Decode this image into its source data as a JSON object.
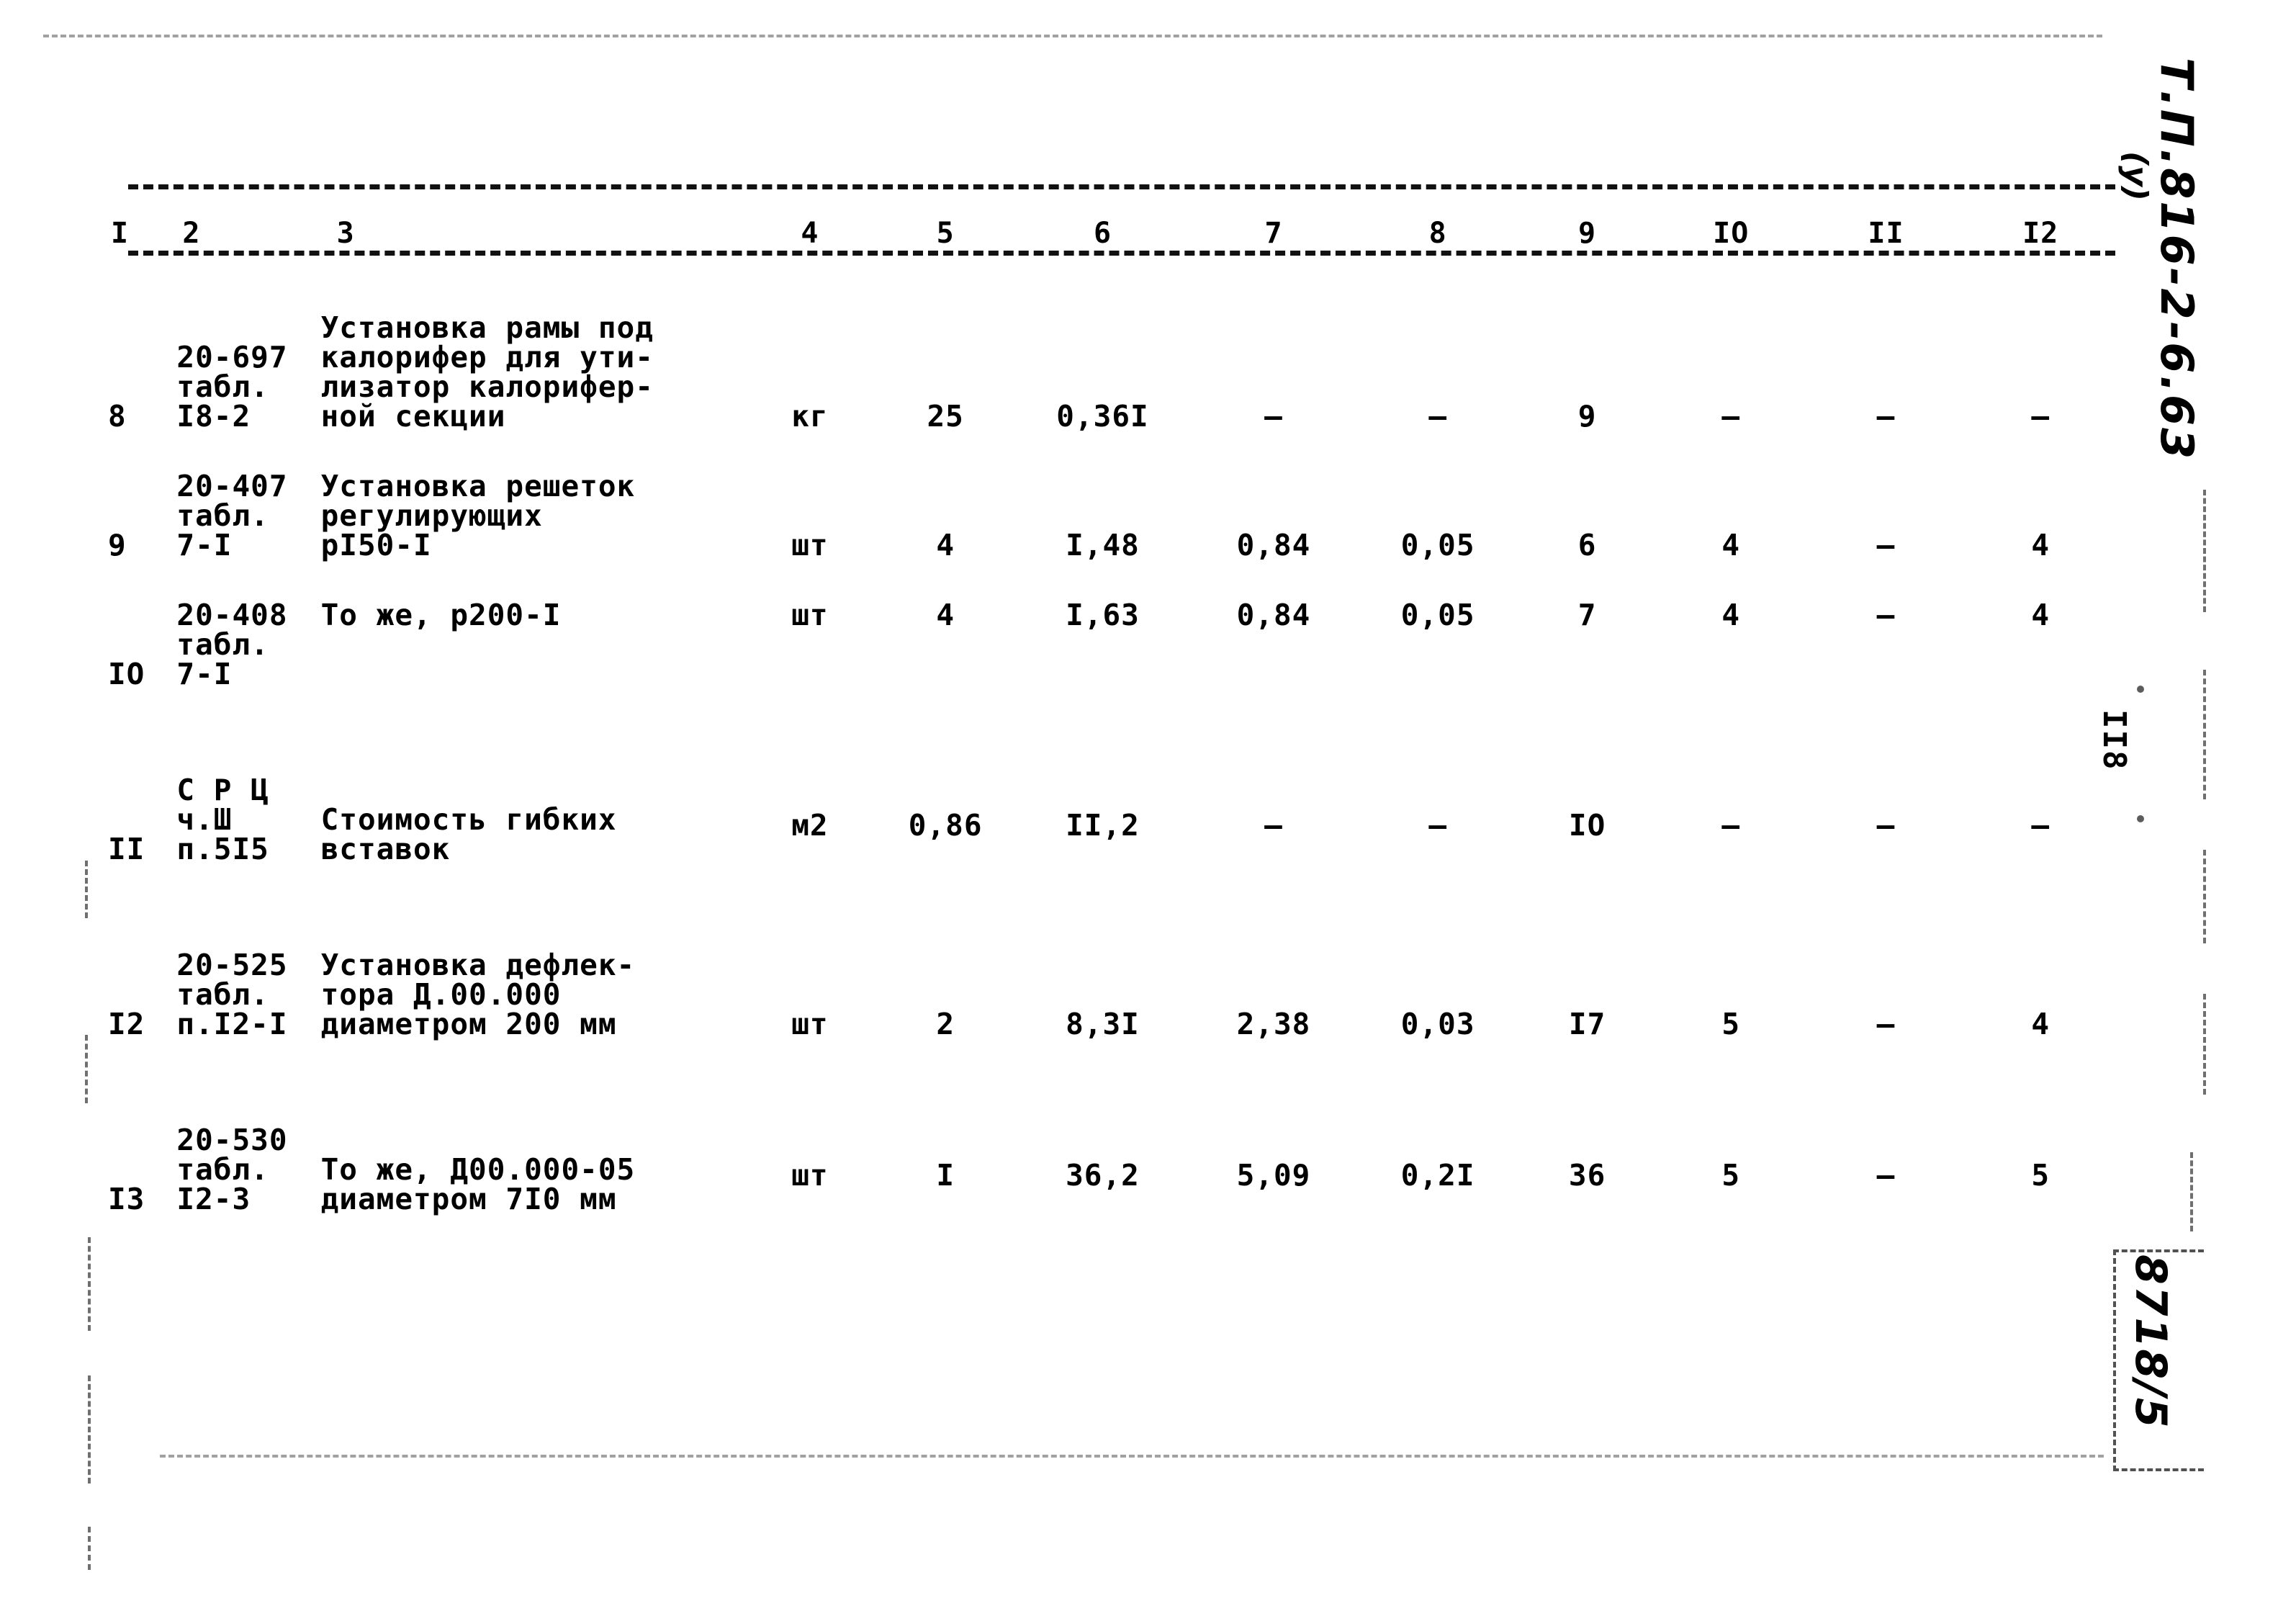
{
  "document": {
    "code": "Т.П.816-2-6.63",
    "code_sub": "(у)",
    "page_number": "II8",
    "sheet_code": "8718/5"
  },
  "table": {
    "headers": [
      "I",
      "2",
      "3",
      "4",
      "5",
      "6",
      "7",
      "8",
      "9",
      "IO",
      "II",
      "I2"
    ],
    "rows": [
      {
        "num": "8",
        "code": "20-697\nтабл.\nI8-2",
        "description": "Установка рамы под\nкалорифер для ути-\nлизатор калорифер-\nной секции",
        "unit": "кг",
        "v5": "25",
        "v6": "0,36I",
        "v7": "–",
        "v8": "–",
        "v9": "9",
        "v10": "–",
        "v11": "–",
        "v12": "–"
      },
      {
        "num": "9",
        "code": "20-407\nтабл.\n7-I",
        "description": "Установка решеток\nрегулирующих\nрI50-I",
        "unit": "шт",
        "v5": "4",
        "v6": "I,48",
        "v7": "0,84",
        "v8": "0,05",
        "v9": "6",
        "v10": "4",
        "v11": "–",
        "v12": "4"
      },
      {
        "num": "IO",
        "code": "20-408\nтабл.\n7-I",
        "description": "То же, р200-I",
        "unit": "шт",
        "v5": "4",
        "v6": "I,63",
        "v7": "0,84",
        "v8": "0,05",
        "v9": "7",
        "v10": "4",
        "v11": "–",
        "v12": "4"
      },
      {
        "num": "II",
        "code": "С Р Ц\nч.Ш\nп.5I5",
        "description": "Стоимость гибких\nвставок",
        "unit": "м2",
        "v5": "0,86",
        "v6": "II,2",
        "v7": "–",
        "v8": "–",
        "v9": "IO",
        "v10": "–",
        "v11": "–",
        "v12": "–"
      },
      {
        "num": "I2",
        "code": "20-525\nтабл.\nп.I2-I",
        "description": "Установка дефлек-\nтора Д.00.000\nдиаметром 200 мм",
        "unit": "шт",
        "v5": "2",
        "v6": "8,3I",
        "v7": "2,38",
        "v8": "0,03",
        "v9": "I7",
        "v10": "5",
        "v11": "–",
        "v12": "4"
      },
      {
        "num": "I3",
        "code": "20-530\nтабл.\nI2-3",
        "description": "То же, Д00.000-05\nдиаметром 7I0 мм",
        "unit": "шт",
        "v5": "I",
        "v6": "36,2",
        "v7": "5,09",
        "v8": "0,2I",
        "v9": "36",
        "v10": "5",
        "v11": "–",
        "v12": "5"
      }
    ]
  }
}
